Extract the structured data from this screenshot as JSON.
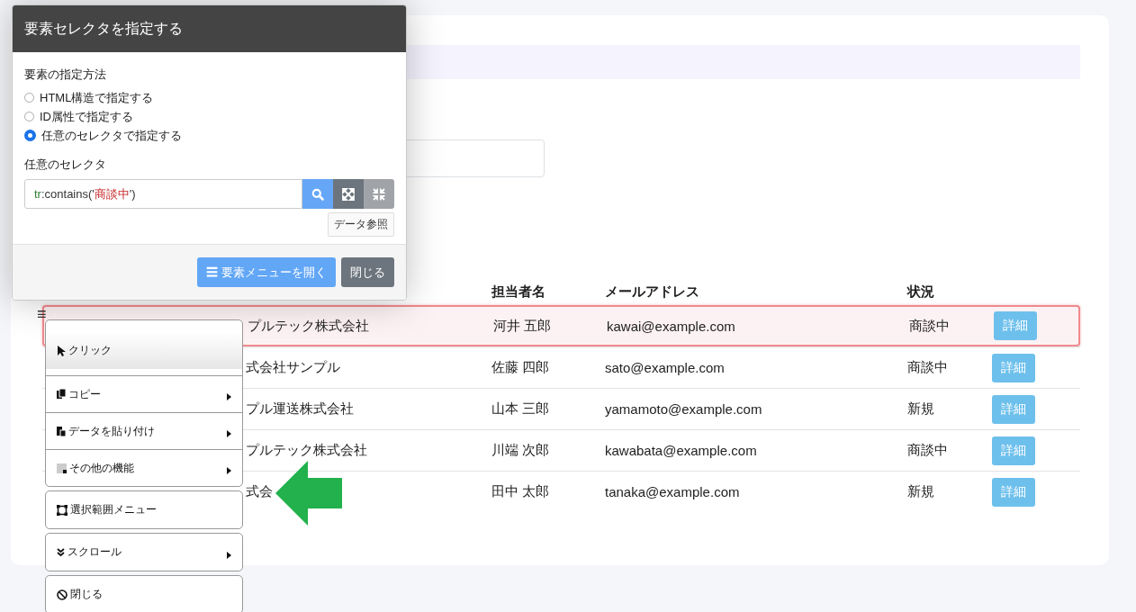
{
  "table": {
    "columns": [
      "",
      "担当者名",
      "メールアドレス",
      "状況",
      ""
    ],
    "rows": [
      {
        "company": "プルテック株式会社",
        "person": "河井 五郎",
        "email": "kawai@example.com",
        "status": "商談中",
        "action": "詳細",
        "highlighted": true
      },
      {
        "company": "式会社サンプル",
        "person": "佐藤 四郎",
        "email": "sato@example.com",
        "status": "商談中",
        "action": "詳細",
        "highlighted": false
      },
      {
        "company": "プル運送株式会社",
        "person": "山本 三郎",
        "email": "yamamoto@example.com",
        "status": "新規",
        "action": "詳細",
        "highlighted": false
      },
      {
        "company": "プルテック株式会社",
        "person": "川端 次郎",
        "email": "kawabata@example.com",
        "status": "商談中",
        "action": "詳細",
        "highlighted": false
      },
      {
        "company": "式会",
        "person": "田中 太郎",
        "email": "tanaka@example.com",
        "status": "新規",
        "action": "詳細",
        "highlighted": false
      }
    ]
  },
  "dialog": {
    "title": "要素セレクタを指定する",
    "method_label": "要素の指定方法",
    "methods": [
      {
        "label": "HTML構造で指定する",
        "selected": false
      },
      {
        "label": "ID属性で指定する",
        "selected": false
      },
      {
        "label": "任意のセレクタで指定する",
        "selected": true
      }
    ],
    "selector_label": "任意のセレクタ",
    "selector_tokens": [
      {
        "kind": "tag",
        "text": "tr"
      },
      {
        "kind": "plain",
        "text": ":contains('"
      },
      {
        "kind": "string",
        "text": "商談中"
      },
      {
        "kind": "plain",
        "text": "')"
      }
    ],
    "data_button": "データ参照",
    "buttons": [
      {
        "kind": "primary",
        "icon": "☰",
        "label": "要素メニューを開く"
      },
      {
        "kind": "secondary",
        "label": "閉じる"
      }
    ]
  },
  "menu": {
    "icon": "≡",
    "groups": [
      [
        {
          "kind": "click",
          "label": "クリック",
          "submenu": false,
          "selected": true
        },
        {
          "kind": "copy",
          "label": "コピー",
          "submenu": true,
          "selected": false
        },
        {
          "kind": "paste",
          "label": "データを貼り付け",
          "submenu": true,
          "selected": false
        },
        {
          "kind": "other",
          "label": "その他の機能",
          "submenu": true,
          "selected": false
        }
      ],
      [
        {
          "kind": "select",
          "label": "選択範囲メニュー",
          "submenu": false,
          "selected": false
        }
      ],
      [
        {
          "kind": "scroll",
          "label": "スクロール",
          "submenu": true,
          "selected": false
        }
      ],
      [
        {
          "kind": "close",
          "label": "閉じる",
          "submenu": false,
          "selected": false
        }
      ]
    ]
  }
}
